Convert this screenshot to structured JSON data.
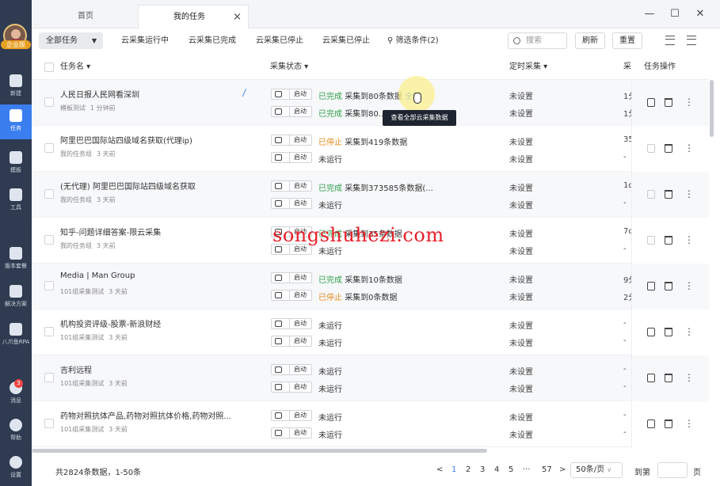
{
  "user": {
    "name": "企业版"
  },
  "sidebar": {
    "items": [
      {
        "label": "新建",
        "icon": "plus-square-icon"
      },
      {
        "label": "任务",
        "icon": "task-flag-icon"
      },
      {
        "label": "模板",
        "icon": "template-icon"
      },
      {
        "label": "工具",
        "icon": "toolbox-icon"
      },
      {
        "label": "版本套餐",
        "icon": "crown-icon"
      },
      {
        "label": "解决方案",
        "icon": "solution-icon"
      },
      {
        "label": "八爪鱼RPA",
        "icon": "octopus-icon"
      },
      {
        "label": "消息",
        "icon": "bell-icon",
        "badge": "3"
      },
      {
        "label": "帮助",
        "icon": "help-icon"
      },
      {
        "label": "设置",
        "icon": "gear-icon"
      }
    ]
  },
  "tabs": [
    {
      "label": "首页"
    },
    {
      "label": "我的任务",
      "close": "×"
    }
  ],
  "window": {
    "minimize": "—",
    "maximize": "☐",
    "close": "✕"
  },
  "toolbar": {
    "all_tasks": "全部任务",
    "filters": [
      "云采集运行中",
      "云采集已完成",
      "云采集已停止",
      "云采集已停止"
    ],
    "filter_conditions": "筛选条件(2)",
    "search_placeholder": "搜索",
    "refresh": "刷新",
    "reset": "重置"
  },
  "table": {
    "columns": {
      "name": "任务名",
      "status": "采集状态",
      "schedule": "定时采集",
      "collect": "采",
      "ops": "任务操作"
    },
    "rows": [
      {
        "name": "人民日报人民网看深圳",
        "group": "模板测试",
        "time": "1 分钟前",
        "cloud": {
          "label": "启动",
          "state": "已完成",
          "text": "采集到80条数据",
          "link": "全部"
        },
        "local": {
          "label": "启动",
          "state": "已完成",
          "text": "采集到80..."
        },
        "sched1": "未设置",
        "sched2": "未设置",
        "c1": "1分",
        "c2": "1分"
      },
      {
        "name": "阿里巴巴国际站四级域名获取(代理ip)",
        "group": "我的任务组",
        "time": "3 天前",
        "cloud": {
          "label": "启动",
          "state": "已停止",
          "text": "采集到419条数据"
        },
        "local": {
          "label": "启动",
          "state": "未运行",
          "text": ""
        },
        "sched1": "未设置",
        "sched2": "未设置",
        "c1": "35",
        "c2": "-"
      },
      {
        "name": "(无代理) 阿里巴巴国际站四级域名获取",
        "group": "我的任务组",
        "time": "3 天前",
        "cloud": {
          "label": "启动",
          "state": "已完成",
          "text": "采集到373585条数据(..."
        },
        "local": {
          "label": "启动",
          "state": "未运行",
          "text": ""
        },
        "sched1": "未设置",
        "sched2": "未设置",
        "c1": "1d",
        "c2": "-"
      },
      {
        "name": "知乎-问题详细答案-限云采集",
        "group": "我的任务组",
        "time": "3 天前",
        "cloud": {
          "label": "启动",
          "state": "已完成",
          "text": "采集到35条数据"
        },
        "local": {
          "label": "启动",
          "state": "未运行",
          "text": ""
        },
        "sched1": "未设置",
        "sched2": "未设置",
        "c1": "7d",
        "c2": "-"
      },
      {
        "name": "Media | Man Group",
        "group": "101组采集测试",
        "time": "3 天前",
        "cloud": {
          "label": "启动",
          "state": "已完成",
          "text": "采集到10条数据"
        },
        "local": {
          "label": "启动",
          "state": "已停止",
          "text": "采集到0条数据"
        },
        "sched1": "未设置",
        "sched2": "未设置",
        "c1": "9分",
        "c2": "2分"
      },
      {
        "name": "机构投资评级-股票-新浪财经",
        "group": "101组采集测试",
        "time": "3 天前",
        "cloud": {
          "label": "启动",
          "state": "未运行",
          "text": ""
        },
        "local": {
          "label": "启动",
          "state": "未运行",
          "text": ""
        },
        "sched1": "未设置",
        "sched2": "未设置",
        "c1": "-",
        "c2": "-"
      },
      {
        "name": "吉利远程",
        "group": "101组采集测试",
        "time": "3 天前",
        "cloud": {
          "label": "启动",
          "state": "未运行",
          "text": ""
        },
        "local": {
          "label": "启动",
          "state": "未运行",
          "text": ""
        },
        "sched1": "未设置",
        "sched2": "未设置",
        "c1": "-",
        "c2": "-"
      },
      {
        "name": "药物对照抗体产品,药物对照抗体价格,药物对照...",
        "group": "101组采集测试",
        "time": "3 天前",
        "cloud": {
          "label": "启动",
          "state": "未运行",
          "text": ""
        },
        "local": {
          "label": "启动",
          "state": "未运行",
          "text": ""
        },
        "sched1": "未设置",
        "sched2": "未设置",
        "c1": "-",
        "c2": "-"
      }
    ]
  },
  "tooltip": "查看全部云采集数据",
  "watermark": "songshuhezi.com",
  "footer": {
    "total": "共2824条数据，1-50条",
    "pages": [
      "<",
      "1",
      "2",
      "3",
      "4",
      "5",
      "···",
      "57",
      ">"
    ],
    "page_size": "50条/页",
    "jump_label": "到第",
    "page_unit": "页"
  },
  "colors": {
    "accent": "#3a7ef0",
    "done": "#2e9f4a",
    "stopped": "#e58a1a",
    "sidebar": "#2f3b50"
  }
}
